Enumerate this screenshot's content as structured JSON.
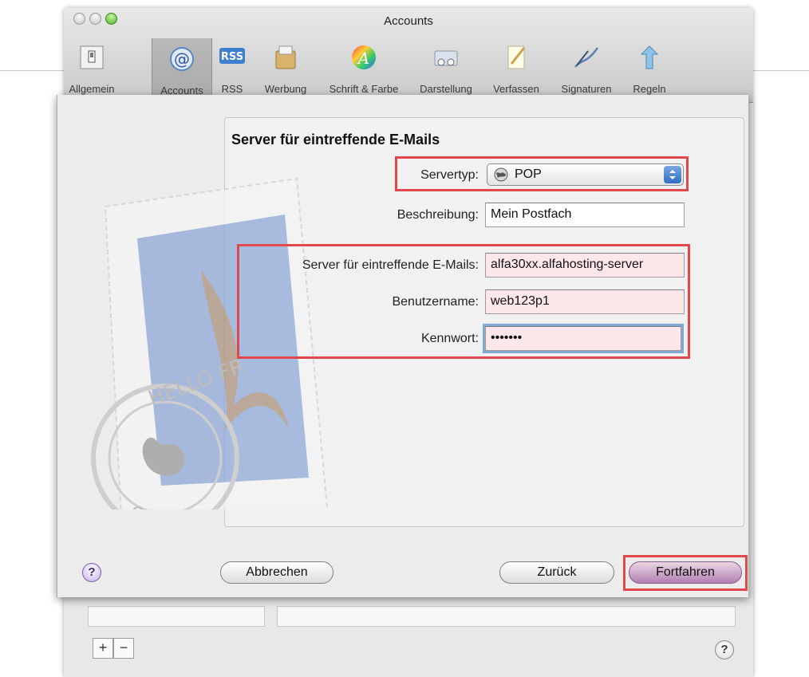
{
  "window": {
    "title": "Accounts"
  },
  "toolbar": {
    "items": [
      {
        "label": "Allgemein",
        "icon": "switch-icon"
      },
      {
        "label": "Accounts",
        "icon": "at-sign-icon"
      },
      {
        "label": "RSS",
        "icon": "rss-icon"
      },
      {
        "label": "Werbung",
        "icon": "junk-mail-bin-icon"
      },
      {
        "label": "Schrift & Farbe",
        "icon": "font-color-icon"
      },
      {
        "label": "Darstellung",
        "icon": "viewing-glasses-icon"
      },
      {
        "label": "Verfassen",
        "icon": "pencil-notepad-icon"
      },
      {
        "label": "Signaturen",
        "icon": "fountain-pen-icon"
      },
      {
        "label": "Regeln",
        "icon": "rules-arrows-icon"
      }
    ],
    "selected": "Accounts",
    "rss_badge": "RSS"
  },
  "sheet": {
    "heading": "Server für eintreffende E-Mails",
    "server_type": {
      "label": "Servertyp:",
      "value": "POP",
      "icon": "globe-icon"
    },
    "description": {
      "label": "Beschreibung:",
      "value": "Mein Postfach"
    },
    "incoming_server": {
      "label": "Server für eintreffende E-Mails:",
      "value": "alfa30xx.alfahosting-server"
    },
    "username": {
      "label": "Benutzername:",
      "value": "web123p1"
    },
    "password": {
      "label": "Kennwort:",
      "value": "•••••••"
    },
    "stamp_text": {
      "top": "HELLO FR",
      "bottom": "CUPERTINO CA"
    },
    "buttons": {
      "cancel": "Abbrechen",
      "back": "Zurück",
      "continue": "Fortfahren"
    },
    "help": "?"
  },
  "background_window": {
    "add": "+",
    "remove": "−",
    "help": "?"
  },
  "colors": {
    "highlight_border": "#e2474d",
    "focus_ring": "#84a8d6",
    "default_button": "#b27fb1"
  }
}
